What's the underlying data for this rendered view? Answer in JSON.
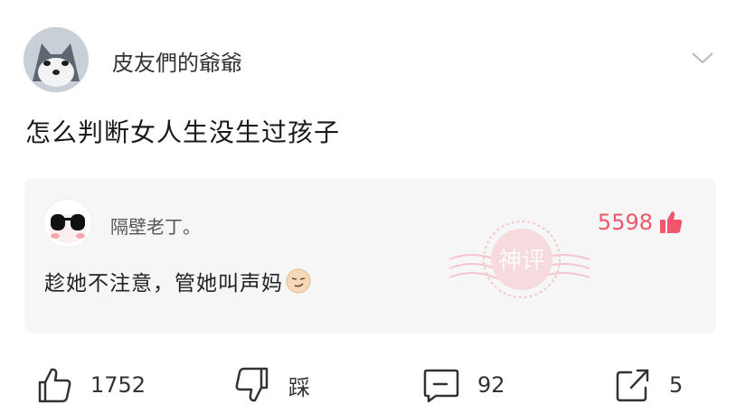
{
  "post": {
    "username": "皮友們的爺爺",
    "text": "怎么判断女人生没生过孩子"
  },
  "hot_comment": {
    "username": "隔壁老丁。",
    "likes": "5598",
    "text": "趁她不注意，管她叫声妈",
    "stamp_text": "神评",
    "emoji": "smirk-emoji"
  },
  "actions": {
    "like_count": "1752",
    "dislike_label": "踩",
    "comment_count": "92",
    "share_count": "5"
  },
  "colors": {
    "accent": "#f0566d",
    "text": "#222222",
    "comment_bg": "#f6f6f6"
  }
}
